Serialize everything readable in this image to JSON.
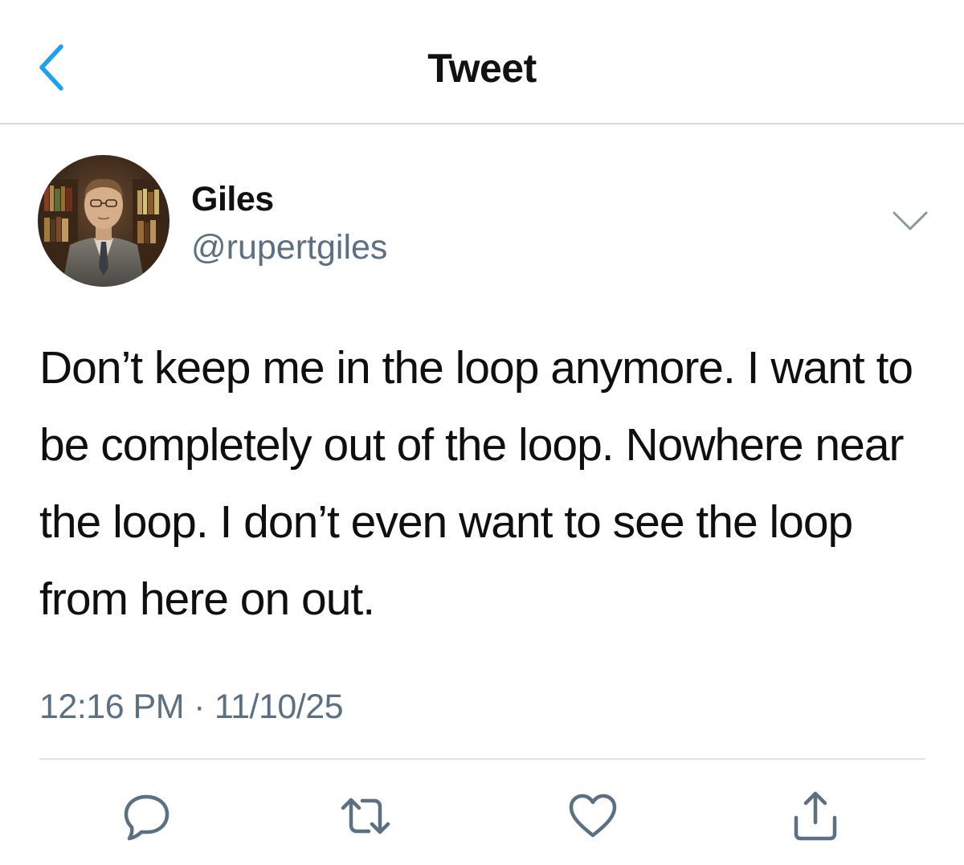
{
  "header": {
    "title": "Tweet",
    "back_icon": "chevron-left-icon"
  },
  "author": {
    "name": "Giles",
    "handle": "@rupertgiles",
    "avatar": "profile-photo",
    "more_icon": "chevron-down-icon"
  },
  "tweet": {
    "text": "Don’t keep me in the loop anymore. I want to be completely out of the loop. Nowhere near the loop. I don’t even want to see the loop from here on out.",
    "time": "12:16 PM",
    "separator": "·",
    "date": "11/10/25"
  },
  "actions": [
    {
      "name": "reply",
      "icon": "comment-icon"
    },
    {
      "name": "retweet",
      "icon": "retweet-icon"
    },
    {
      "name": "like",
      "icon": "heart-icon"
    },
    {
      "name": "share",
      "icon": "share-icon"
    }
  ],
  "colors": {
    "accent": "#1da1f2",
    "secondary_text": "#5b7083",
    "divider": "#dfe3e6",
    "icon": "#5b7083"
  }
}
